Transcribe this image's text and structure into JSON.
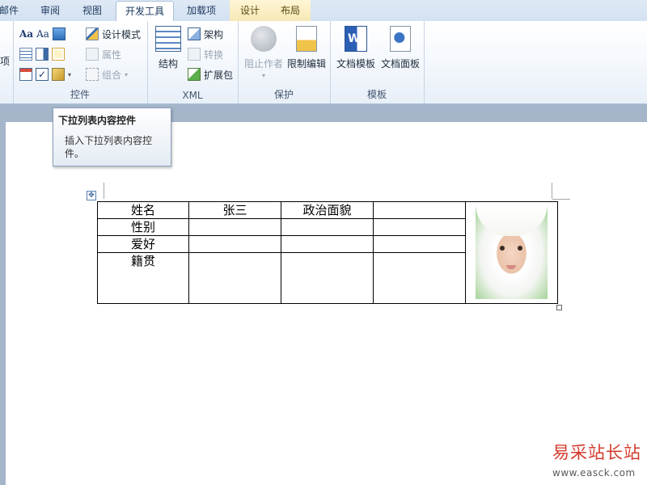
{
  "ribbon_tabs": [
    {
      "label": "邮件"
    },
    {
      "label": "审阅"
    },
    {
      "label": "视图"
    },
    {
      "label": "开发工具",
      "active": true
    },
    {
      "label": "加载项"
    },
    {
      "label": "设计"
    },
    {
      "label": "布局"
    }
  ],
  "ribbon": {
    "left_fragment": "项",
    "controls": {
      "label": "控件",
      "design_mode": "设计模式",
      "properties": "属性",
      "group": "组合"
    },
    "xml": {
      "label": "XML",
      "structure": "结构",
      "schema": "架构",
      "transform": "转换",
      "expansion_pack": "扩展包"
    },
    "protect": {
      "label": "保护",
      "block_authors": "阻止作者",
      "restrict_editing": "限制编辑"
    },
    "templates": {
      "label": "模板",
      "document_template": "文档模板",
      "document_panel": "文档面板"
    }
  },
  "tooltip": {
    "title": "下拉列表内容控件",
    "body": "插入下拉列表内容控件。"
  },
  "table": {
    "rows": [
      [
        "姓名",
        "张三",
        "政治面貌",
        ""
      ],
      [
        "性别",
        "",
        "",
        ""
      ],
      [
        "爱好",
        "",
        "",
        ""
      ],
      [
        "籍贯",
        "",
        "",
        ""
      ]
    ]
  },
  "watermark": {
    "text": "易采站长站",
    "url": "www.easck.com"
  },
  "colors": {
    "ribbon_tab_bar": "#d3e1f1",
    "document_background": "#a5b6cb",
    "watermark_red": "#d43c2e",
    "contextual_tab": "#f6e8b5"
  }
}
